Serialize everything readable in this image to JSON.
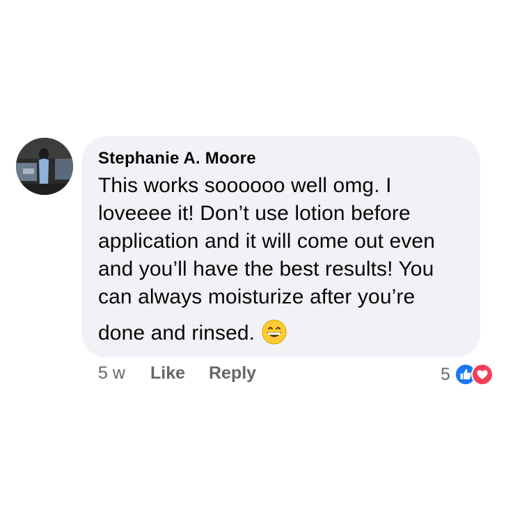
{
  "comment": {
    "author": "Stephanie A. Moore",
    "lines": [
      "This works soooooo well omg. I",
      "loveeee it! Don’t use lotion before",
      "application and it will come out even",
      "and you’ll have the best results! You",
      "can always moisturize after you’re",
      "done and rinsed."
    ],
    "emoji": "grinning-face-icon"
  },
  "actions": {
    "time": "5 w",
    "like_label": "Like",
    "reply_label": "Reply"
  },
  "reactions": {
    "count": "5",
    "types": [
      "like-reaction-icon",
      "love-reaction-icon"
    ]
  },
  "colors": {
    "bubble": "#f0f2f5",
    "text": "#050505",
    "meta": "#65676b",
    "like_blue": "#1877f2",
    "love_red": "#f33e58"
  }
}
